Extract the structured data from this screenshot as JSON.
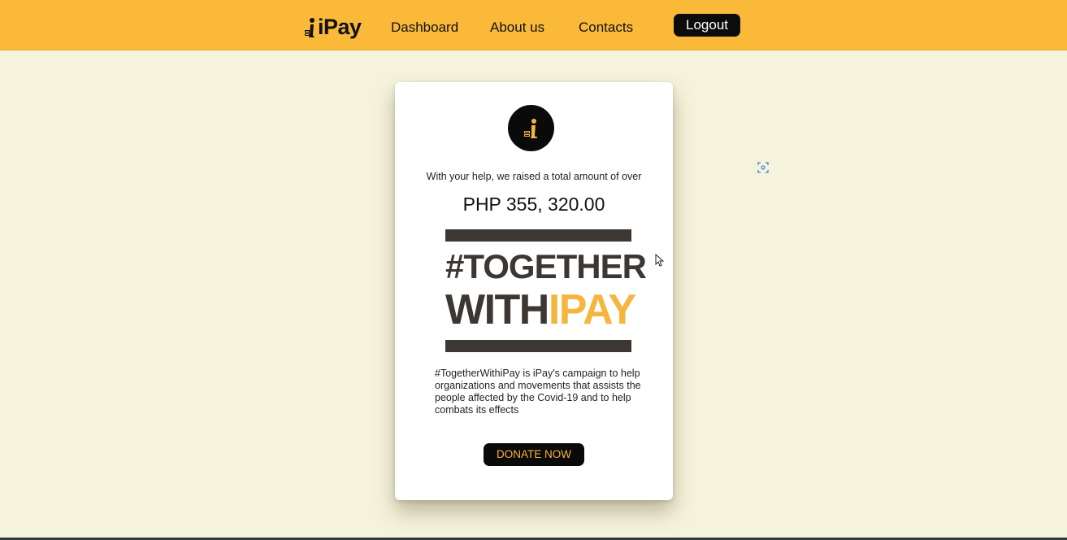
{
  "header": {
    "brand": "iPay",
    "nav": [
      {
        "label": "Dashboard"
      },
      {
        "label": "About us"
      },
      {
        "label": "Contacts"
      }
    ],
    "logout_label": "Logout"
  },
  "card": {
    "intro_text": "With your help, we raised a total amount of over",
    "amount": "PHP 355, 320.00",
    "banner": {
      "line1": "#TOGETHER",
      "line2_part1": "WITH",
      "line2_part2": "IPAY"
    },
    "description": "#TogetherWithiPay is iPay's campaign to help organizations and movements that assists the people affected by the Covid-19 and to help combats its effects",
    "donate_label": "DONATE NOW"
  },
  "colors": {
    "header_bg": "#fbb93a",
    "page_bg": "#f6f3dd",
    "accent": "#f4b63f",
    "dark": "#0a0a0a",
    "banner_dark": "#3d3733"
  },
  "icons": {
    "brand_logo": "ipay-logo-icon",
    "card_logo": "ipay-circle-logo-icon",
    "focus": "focus-frame-icon",
    "cursor": "mouse-cursor-icon"
  }
}
